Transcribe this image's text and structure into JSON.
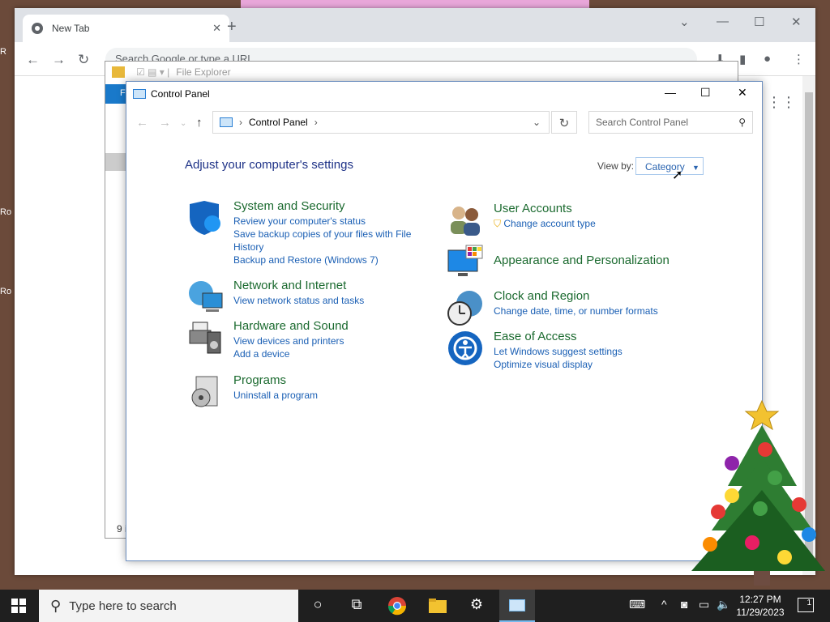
{
  "desktop": {
    "icon_labels": [
      "R",
      "Ro",
      "Ro"
    ]
  },
  "chrome": {
    "tab_title": "New Tab",
    "omnibox_placeholder": "Search Google or type a URL"
  },
  "file_explorer": {
    "title": "File Explorer",
    "ribbon_file": "F",
    "status": "9 i"
  },
  "control_panel": {
    "window_title": "Control Panel",
    "breadcrumb": "Control Panel",
    "search_placeholder": "Search Control Panel",
    "heading": "Adjust your computer's settings",
    "view_by_label": "View by:",
    "view_by_value": "Category",
    "categories": [
      {
        "title": "System and Security",
        "links": [
          "Review your computer's status",
          "Save backup copies of your files with File History",
          "Backup and Restore (Windows 7)"
        ],
        "icon": "shield-icon"
      },
      {
        "title": "Network and Internet",
        "links": [
          "View network status and tasks"
        ],
        "icon": "network-globe-icon"
      },
      {
        "title": "Hardware and Sound",
        "links": [
          "View devices and printers",
          "Add a device"
        ],
        "icon": "printer-speaker-icon"
      },
      {
        "title": "Programs",
        "links": [
          "Uninstall a program"
        ],
        "icon": "programs-disc-icon"
      },
      {
        "title": "User Accounts",
        "links": [
          "Change account type"
        ],
        "icon": "users-icon"
      },
      {
        "title": "Appearance and Personalization",
        "links": [],
        "icon": "monitor-palette-icon"
      },
      {
        "title": "Clock and Region",
        "links": [
          "Change date, time, or number formats"
        ],
        "icon": "clock-globe-icon"
      },
      {
        "title": "Ease of Access",
        "links": [
          "Let Windows suggest settings",
          "Optimize visual display"
        ],
        "icon": "ease-of-access-icon"
      }
    ]
  },
  "taskbar": {
    "search_placeholder": "Type here to search",
    "time": "12:27 PM",
    "date": "11/29/2023",
    "notification_count": "1"
  },
  "colors": {
    "accent": "#0078d7",
    "link": "#1a5fb4",
    "category_title": "#1b6a2f",
    "heading": "#1e3287"
  }
}
